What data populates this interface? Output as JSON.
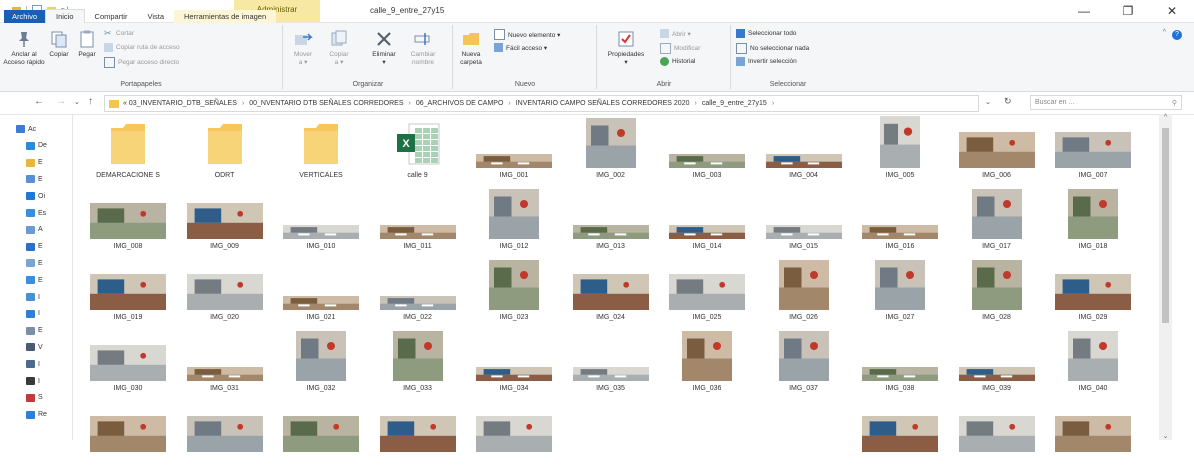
{
  "window": {
    "context_tab": "Administrar",
    "title": "calle_9_entre_27y15",
    "minimize": "—",
    "maximize": "❐",
    "close": "✕"
  },
  "tabs": [
    "Archivo",
    "Inicio",
    "Compartir",
    "Vista",
    "Herramientas de imagen"
  ],
  "ribbon": {
    "portapapeles": {
      "label": "Portapapeles",
      "pin": "Anclar al\nAcceso rápido",
      "copy": "Copiar",
      "paste": "Pegar",
      "cut": "Cortar",
      "copy_path": "Copiar ruta de acceso",
      "paste_shortcut": "Pegar acceso directo"
    },
    "organizar": {
      "label": "Organizar",
      "move": "Mover\na ▾",
      "copy_to": "Copiar\na ▾",
      "delete": "Eliminar\n▾",
      "rename": "Cambiar\nnombre"
    },
    "nuevo": {
      "label": "Nuevo",
      "new_folder": "Nueva\ncarpeta",
      "new_item": "Nuevo elemento ▾",
      "easy_access": "Fácil acceso ▾"
    },
    "abrir": {
      "label": "Abrir",
      "properties": "Propiedades\n▾",
      "open": "Abrir ▾",
      "edit": "Modificar",
      "history": "Historial"
    },
    "seleccionar": {
      "label": "Seleccionar",
      "select_all": "Seleccionar todo",
      "select_none": "No seleccionar nada",
      "invert": "Invertir selección"
    }
  },
  "address": {
    "crumbs": [
      "«  03_INVENTARIO_DTB_SEÑALES",
      "00_NVENTARIO DTB SEÑALES CORREDORES",
      "06_ARCHIVOS DE CAMPO",
      "INVENTARIO CAMPO SEÑALES CORREDORES 2020",
      "calle_9_entre_27y15"
    ],
    "search_placeholder": "Buscar en ..."
  },
  "nav_items": [
    {
      "label": "Ac",
      "color": "#3b7dd8"
    },
    {
      "label": "De",
      "color": "#2a8ad8"
    },
    {
      "label": "E",
      "color": "#e8b73a"
    },
    {
      "label": "E",
      "color": "#5b8fd1"
    },
    {
      "label": "Oi",
      "color": "#1e78d6"
    },
    {
      "label": "Es",
      "color": "#3a8ee0"
    },
    {
      "label": "A",
      "color": "#6c9bd1"
    },
    {
      "label": "E",
      "color": "#2d6fc7"
    },
    {
      "label": "E",
      "color": "#7aa3d6"
    },
    {
      "label": "E",
      "color": "#3a8ee0"
    },
    {
      "label": "I",
      "color": "#4a90d9"
    },
    {
      "label": "I",
      "color": "#2f7fd8"
    },
    {
      "label": "E",
      "color": "#7d8fa6"
    },
    {
      "label": "V",
      "color": "#4a5a70"
    },
    {
      "label": "I",
      "color": "#4d6b91"
    },
    {
      "label": "I",
      "color": "#3a3a3a"
    },
    {
      "label": "S",
      "color": "#c43a3a"
    },
    {
      "label": "Re",
      "color": "#2d7fd8"
    }
  ],
  "files": [
    {
      "name": "DEMARCACIONE S",
      "kind": "folder"
    },
    {
      "name": "ODRT",
      "kind": "folder"
    },
    {
      "name": "VERTICALES",
      "kind": "folder"
    },
    {
      "name": "calle 9",
      "kind": "excel"
    },
    {
      "name": "IMG_001",
      "kind": "wide"
    },
    {
      "name": "IMG_002",
      "kind": "square"
    },
    {
      "name": "IMG_003",
      "kind": "wide"
    },
    {
      "name": "IMG_004",
      "kind": "wide"
    },
    {
      "name": "IMG_005",
      "kind": "tall"
    },
    {
      "name": "IMG_006",
      "kind": "wide2"
    },
    {
      "name": "IMG_007",
      "kind": "wide2"
    },
    {
      "name": "IMG_008",
      "kind": "wide2"
    },
    {
      "name": "IMG_009",
      "kind": "wide2"
    },
    {
      "name": "IMG_010",
      "kind": "wide"
    },
    {
      "name": "IMG_011",
      "kind": "wide"
    },
    {
      "name": "IMG_012",
      "kind": "square"
    },
    {
      "name": "IMG_013",
      "kind": "wide"
    },
    {
      "name": "IMG_014",
      "kind": "wide"
    },
    {
      "name": "IMG_015",
      "kind": "wide"
    },
    {
      "name": "IMG_016",
      "kind": "wide"
    },
    {
      "name": "IMG_017",
      "kind": "square"
    },
    {
      "name": "IMG_018",
      "kind": "square"
    },
    {
      "name": "IMG_019",
      "kind": "wide2"
    },
    {
      "name": "IMG_020",
      "kind": "wide2"
    },
    {
      "name": "IMG_021",
      "kind": "wide"
    },
    {
      "name": "IMG_022",
      "kind": "wide"
    },
    {
      "name": "IMG_023",
      "kind": "square"
    },
    {
      "name": "IMG_024",
      "kind": "wide2"
    },
    {
      "name": "IMG_025",
      "kind": "wide2"
    },
    {
      "name": "IMG_026",
      "kind": "square"
    },
    {
      "name": "IMG_027",
      "kind": "square"
    },
    {
      "name": "IMG_028",
      "kind": "square"
    },
    {
      "name": "IMG_029",
      "kind": "wide2"
    },
    {
      "name": "IMG_030",
      "kind": "wide2"
    },
    {
      "name": "IMG_031",
      "kind": "wide"
    },
    {
      "name": "IMG_032",
      "kind": "square"
    },
    {
      "name": "IMG_033",
      "kind": "square"
    },
    {
      "name": "IMG_034",
      "kind": "wide"
    },
    {
      "name": "IMG_035",
      "kind": "wide"
    },
    {
      "name": "IMG_036",
      "kind": "square"
    },
    {
      "name": "IMG_037",
      "kind": "square"
    },
    {
      "name": "IMG_038",
      "kind": "wide"
    },
    {
      "name": "IMG_039",
      "kind": "wide"
    },
    {
      "name": "IMG_040",
      "kind": "square"
    },
    {
      "name": "",
      "kind": "wide2"
    },
    {
      "name": "",
      "kind": "wide2"
    },
    {
      "name": "",
      "kind": "wide2"
    },
    {
      "name": "",
      "kind": "wide2"
    },
    {
      "name": "",
      "kind": "wide2"
    },
    {
      "name": "",
      "kind": "none"
    },
    {
      "name": "",
      "kind": "none"
    },
    {
      "name": "",
      "kind": "none"
    },
    {
      "name": "",
      "kind": "wide2"
    },
    {
      "name": "",
      "kind": "wide2"
    },
    {
      "name": "",
      "kind": "wide2"
    }
  ],
  "colors": {
    "accent": "#1a5fb4",
    "folder": "#f6c75a",
    "excel": "#1e7145"
  }
}
